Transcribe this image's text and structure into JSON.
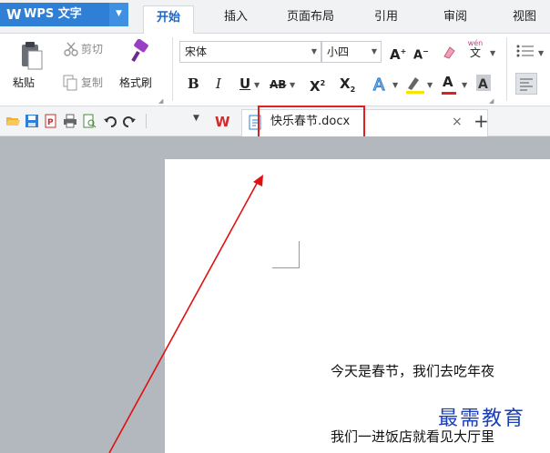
{
  "app": {
    "logo": "W",
    "title": "WPS 文字",
    "menu_arrow": "▼"
  },
  "tabs": [
    {
      "label": "开始",
      "active": true
    },
    {
      "label": "插入"
    },
    {
      "label": "页面布局"
    },
    {
      "label": "引用"
    },
    {
      "label": "审阅"
    },
    {
      "label": "视图"
    }
  ],
  "ribbon": {
    "paste": "粘贴",
    "cut": "剪切",
    "copy": "复制",
    "format_painter": "格式刷",
    "font_name": "宋体",
    "font_size": "小四",
    "grow": "A",
    "shrink": "A",
    "phonetic": "wén",
    "phonetic_char": "文",
    "bold": "B",
    "italic": "I",
    "underline": "U",
    "strike": "AB",
    "superscript": "X",
    "subscript": "X",
    "font_color": "A"
  },
  "document_tab": {
    "name": "快乐春节.docx",
    "close": "×",
    "new": "+"
  },
  "document": {
    "para1": "今天是春节，我们去吃年夜",
    "para2": "我们一进饭店就看见大厅里"
  },
  "watermark": "最需教育",
  "colors": {
    "accent": "#2f7fd6",
    "highlight": "#e02020",
    "arrow": "#e01010",
    "watermark": "#1a3fb8"
  }
}
